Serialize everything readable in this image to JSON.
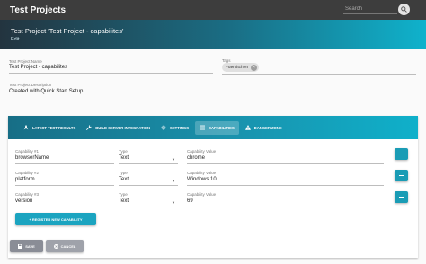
{
  "app": {
    "title": "Test Projects"
  },
  "search": {
    "placeholder": "Search"
  },
  "header": {
    "project_title": "Test Project 'Test Project - capabilites'",
    "edit_label": "Edit"
  },
  "project": {
    "name_label": "Test Project Name",
    "name_value": "Test Project - capabilites",
    "tags_label": "Tags",
    "tags": [
      "Fuerkitchen"
    ],
    "description_label": "Test Project Description",
    "description_value": "Created with Quick Start Setup"
  },
  "tabs": [
    {
      "label": "LATEST TEST RESULTS",
      "icon": "rocket-icon",
      "active": false
    },
    {
      "label": "BUILD SERVER INTEGRATION",
      "icon": "wrench-icon",
      "active": false
    },
    {
      "label": "SETTINGS",
      "icon": "gear-icon",
      "active": false
    },
    {
      "label": "CAPABILITIES",
      "icon": "list-icon",
      "active": true
    },
    {
      "label": "DANGER ZONE",
      "icon": "warning-icon",
      "active": false
    }
  ],
  "capabilities": [
    {
      "name_label": "Capability #1",
      "name": "browserName",
      "type_label": "Type",
      "type": "Text",
      "value_label": "Capability Value",
      "value": "chrome"
    },
    {
      "name_label": "Capability #2",
      "name": "platform",
      "type_label": "Type",
      "type": "Text",
      "value_label": "Capability Value",
      "value": "Windows 10"
    },
    {
      "name_label": "Capability #3",
      "name": "version",
      "type_label": "Type",
      "type": "Text",
      "value_label": "Capability Value",
      "value": "69"
    }
  ],
  "buttons": {
    "register": "+ REGISTER NEW CAPABILITY",
    "save": "SAVE",
    "cancel": "CANCEL"
  },
  "colors": {
    "topbar": "#3d3d3d",
    "accent": "#1ba4c0",
    "header_start": "#23343f",
    "header_end": "#0fb2cc"
  }
}
